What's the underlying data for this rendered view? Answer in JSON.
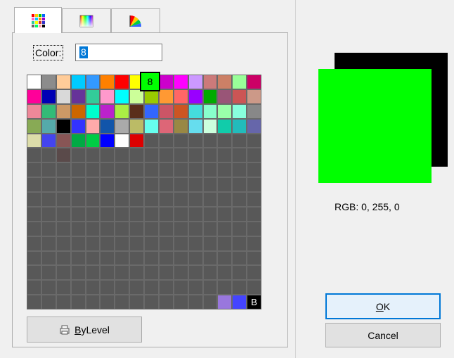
{
  "tabs": [
    {
      "name": "palette-grid",
      "icon": "color-grid-icon",
      "active": true
    },
    {
      "name": "spectrum",
      "icon": "spectrum-icon",
      "active": false
    },
    {
      "name": "color-wheel",
      "icon": "color-wheel-icon",
      "active": false
    }
  ],
  "color_label": "Color:",
  "color_input_value": "8",
  "selected_cell_text": "8",
  "last_cell_text": "B",
  "bylevel_button": {
    "accel": "B",
    "rest": "yLevel",
    "icon": "printer-icon"
  },
  "rgb_text": "RGB: 0, 255, 0",
  "ok_button": {
    "accel": "O",
    "rest": "K"
  },
  "cancel_button": "Cancel",
  "preview": {
    "previous_color": "#000000",
    "current_color": "#00ff00"
  },
  "palette": {
    "columns": 16,
    "rows": 16,
    "empty_color": "#585858",
    "colors": [
      "#ffffff",
      "#8c8c8c",
      "#ffcc99",
      "#00ccff",
      "#3399ff",
      "#ff8000",
      "#ff0000",
      "#ffff00",
      "#00ff00",
      "#cc00cc",
      "#ff00ff",
      "#cc99ff",
      "#cc7a7a",
      "#cc8066",
      "#99ff99",
      "#cc0066",
      "#ff0099",
      "#0000b4",
      "#d9d9d9",
      "#663399",
      "#33cc99",
      "#ff99cc",
      "#00ffff",
      "#ccff99",
      "#99cc00",
      "#ff9933",
      "#ff6666",
      "#9900ff",
      "#00aa00",
      "#995577",
      "#cc5555",
      "#cc9988",
      "#ee8899",
      "#33bb77",
      "#cc9966",
      "#cc6600",
      "#00ffcc",
      "#bb22cc",
      "#aaee44",
      "#5a2e1a",
      "#3366ff",
      "#cc5566",
      "#cc5522",
      "#44dddd",
      "#88ffcc",
      "#99ffaa",
      "#88ffdd",
      "#888888",
      "#88aa55",
      "#55aaaa",
      "#000000",
      "#3333ff",
      "#ffaaaa",
      "#1155aa",
      "#aaaaaa",
      "#bbbb66",
      "#66ffee",
      "#dd6677",
      "#998844",
      "#66ddee",
      "#ccffdd",
      "#11ccaa",
      "#22bbbb",
      "#6666aa",
      "#ddddaa",
      "#4444ee",
      "#885555",
      "#00aa44",
      "#00cc44",
      "#0000ff",
      "#ffffff",
      "#dd0000",
      null,
      null,
      null,
      null,
      null,
      null,
      null,
      null,
      null,
      null,
      "#5a4a4a"
    ],
    "bottom_right_colors": [
      "#9977dd",
      "#4444ff",
      "#000000"
    ]
  }
}
